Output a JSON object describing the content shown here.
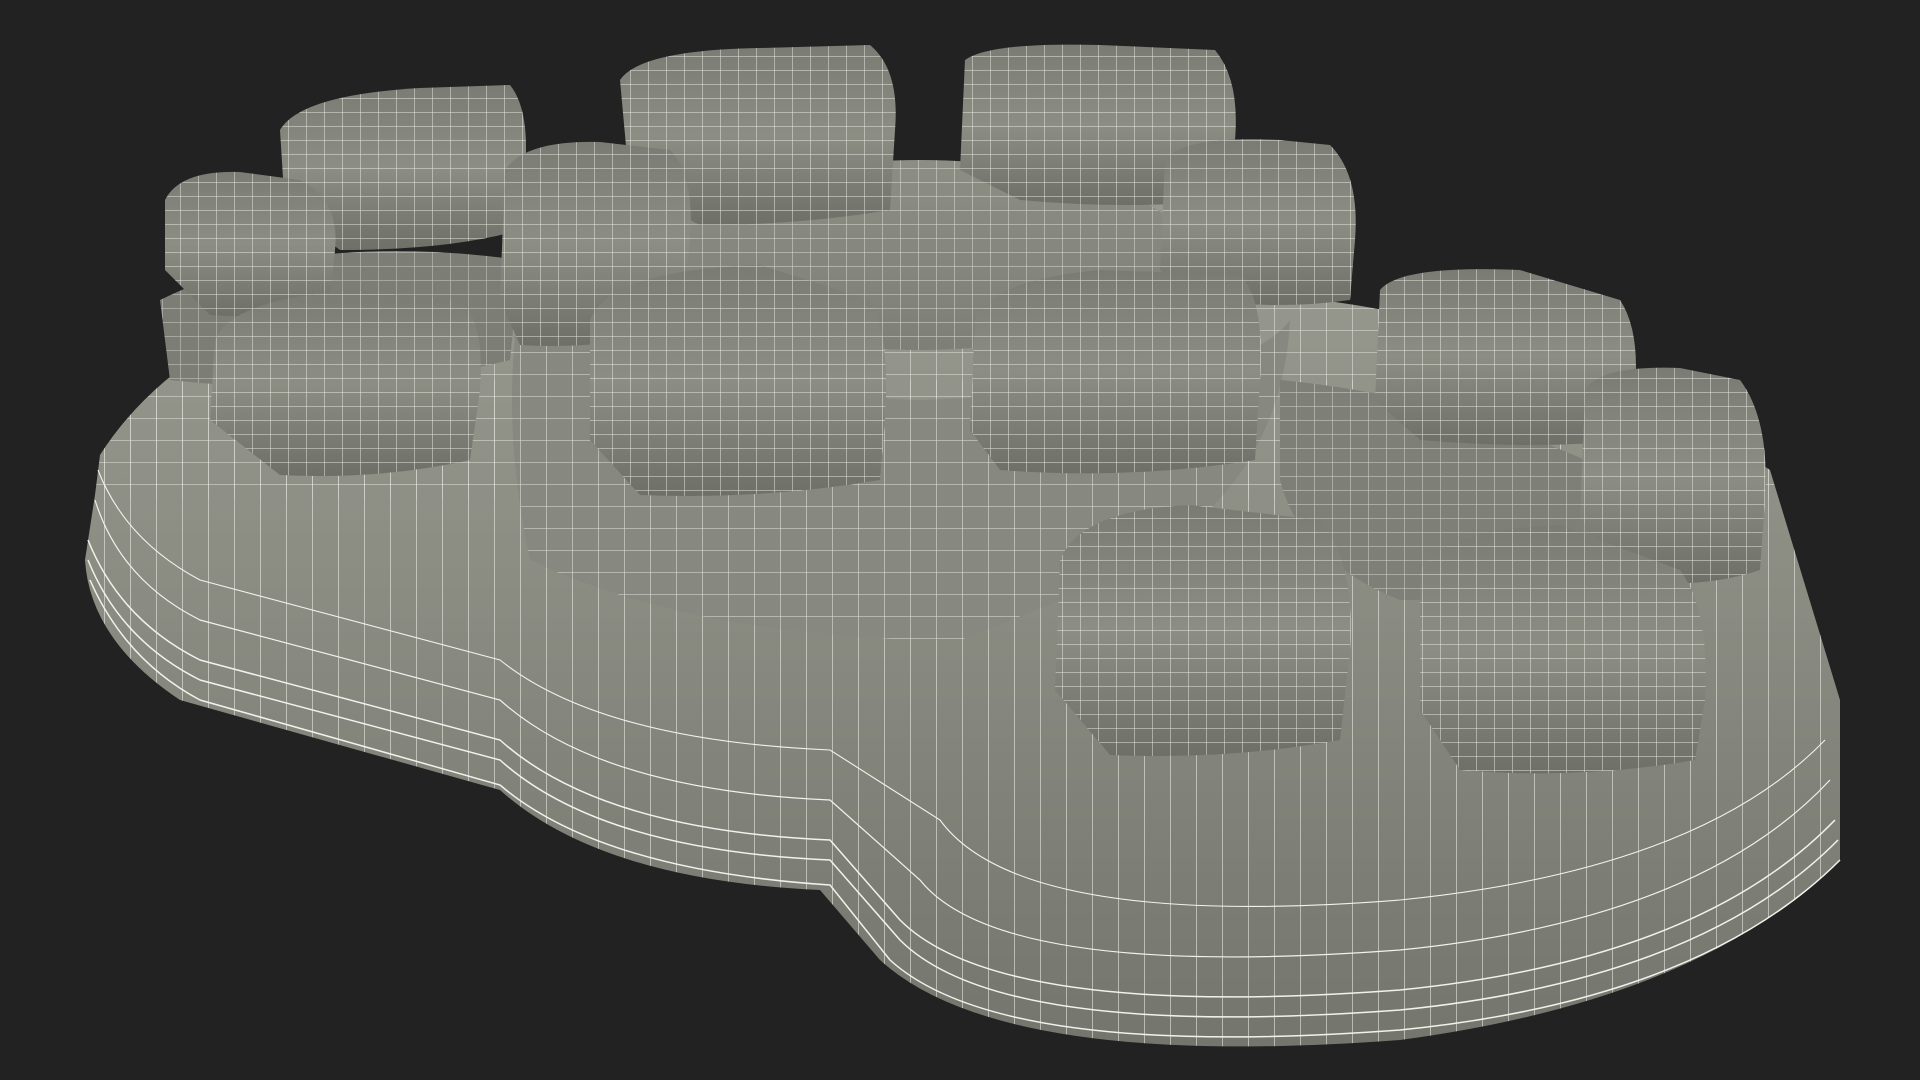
{
  "scene": {
    "subject": "wireframe-render",
    "colors": {
      "background": "#222222",
      "surface": "#8a8c82",
      "surface_light": "#a4a69c",
      "surface_dark": "#5e6058",
      "wire": "#f2f2ec"
    }
  }
}
